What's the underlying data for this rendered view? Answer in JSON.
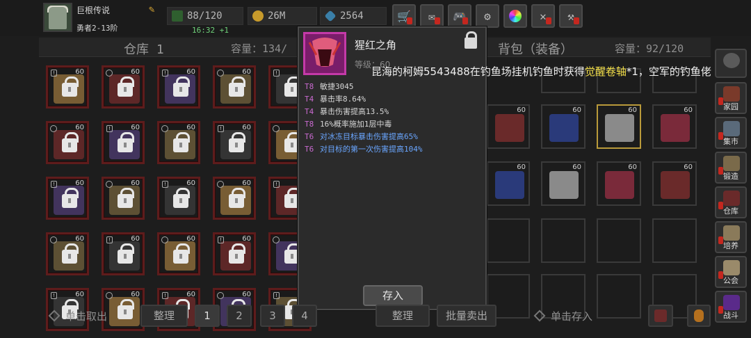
{
  "player": {
    "name": "巨根传说",
    "rank": "勇者2-13阶"
  },
  "stats": {
    "energy": "88/120",
    "gold": "26M",
    "gems": "2564",
    "timer": "16:32 +1"
  },
  "warehouse": {
    "title": "仓库 1",
    "capacity": "容量：134/",
    "level_labels": "60"
  },
  "backpack": {
    "title": "背包（装备）",
    "capacity": "容量：92/120"
  },
  "tooltip": {
    "name": "猩红之角",
    "level": "等级：60",
    "attributes": [
      {
        "tier": "T8",
        "text": "敏捷3045",
        "style": "normal"
      },
      {
        "tier": "T4",
        "text": "暴击率8.64%",
        "style": "normal"
      },
      {
        "tier": "T4",
        "text": "暴击伤害提高13.5%",
        "style": "normal"
      },
      {
        "tier": "T8",
        "text": "16%概率施加1层中毒",
        "style": "normal"
      },
      {
        "tier": "T6",
        "text": "对冰冻目标暴击伤害提高65%",
        "style": "blue"
      },
      {
        "tier": "T6",
        "text": "对目标的第一次伤害提高104%",
        "style": "blue"
      }
    ],
    "store_button": "存入"
  },
  "announcement": {
    "part1": "昆海的柯姆5543488在钓鱼场挂机钓鱼时获得",
    "highlight": "觉醒卷轴",
    "part2": "*1，空军的钓鱼佬"
  },
  "sidebar": [
    {
      "label": "家园",
      "icon": "home-icon"
    },
    {
      "label": "集市",
      "icon": "market-icon"
    },
    {
      "label": "锻造",
      "icon": "anvil-icon"
    },
    {
      "label": "仓库",
      "icon": "warehouse-icon"
    },
    {
      "label": "培养",
      "icon": "training-icon"
    },
    {
      "label": "公会",
      "icon": "guild-icon"
    },
    {
      "label": "战斗",
      "icon": "battle-icon"
    }
  ],
  "bottom": {
    "take_out": "单击取出",
    "sort_left": "整理",
    "pages": [
      "1",
      "2",
      "3",
      "4"
    ],
    "sort_right": "整理",
    "batch_sell": "批量卖出",
    "store_click": "单击存入"
  },
  "colors": {
    "slot_border": "#5e1c1c",
    "highlight": "#f4e04a",
    "blue_attr": "#6aa6ff",
    "tier": "#c96ad0"
  }
}
